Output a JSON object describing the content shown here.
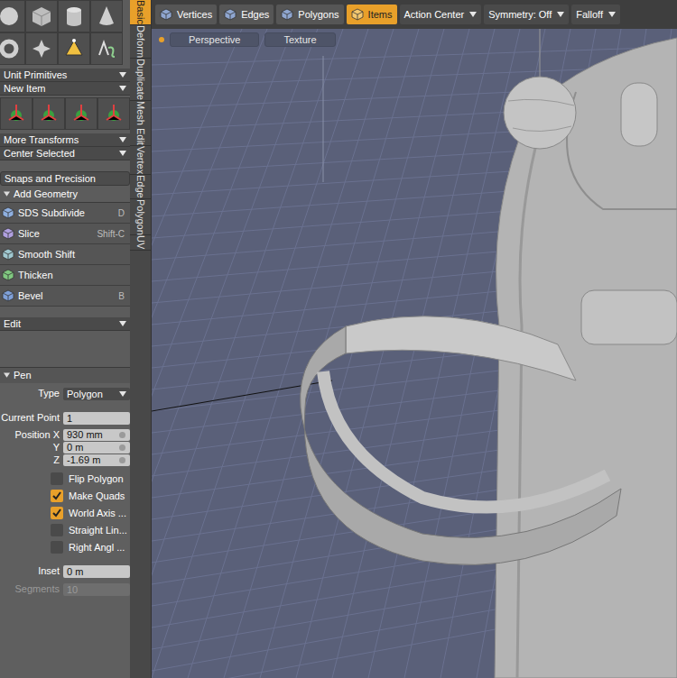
{
  "toolbar": {
    "modes": [
      {
        "label": "Vertices",
        "selected": false
      },
      {
        "label": "Edges",
        "selected": false
      },
      {
        "label": "Polygons",
        "selected": false
      },
      {
        "label": "Items",
        "selected": true
      }
    ],
    "menus": [
      "Action Center",
      "Symmetry: Off",
      "Falloff"
    ]
  },
  "viewport": {
    "labels": [
      "Perspective",
      "Texture"
    ]
  },
  "side_tabs": [
    {
      "label": "Basic",
      "selected": true
    },
    {
      "label": "Deform",
      "selected": false
    },
    {
      "label": "Duplicate",
      "selected": false
    },
    {
      "label": "Mesh Edit",
      "selected": false
    },
    {
      "label": "Vertex",
      "selected": false
    },
    {
      "label": "Edge",
      "selected": false
    },
    {
      "label": "Polygon",
      "selected": false
    },
    {
      "label": "UV",
      "selected": false
    }
  ],
  "primitive_dropdowns": [
    "Unit Primitives",
    "New Item"
  ],
  "transform_dropdowns": [
    "More Transforms",
    "Center Selected"
  ],
  "snaps_button": "Snaps and Precision",
  "add_geometry": {
    "title": "Add Geometry",
    "tools": [
      {
        "label": "SDS Subdivide",
        "shortcut": "D"
      },
      {
        "label": "Slice",
        "shortcut": "Shift-C"
      },
      {
        "label": "Smooth Shift",
        "shortcut": ""
      },
      {
        "label": "Thicken",
        "shortcut": ""
      },
      {
        "label": "Bevel",
        "shortcut": "B"
      }
    ]
  },
  "edit_dropdown": "Edit",
  "pen": {
    "title": "Pen",
    "type": {
      "label": "Type",
      "value": "Polygon"
    },
    "current_point": {
      "label": "Current Point",
      "value": "1"
    },
    "position": [
      {
        "label": "Position X",
        "value": "930 mm"
      },
      {
        "label": "Y",
        "value": "0 m"
      },
      {
        "label": "Z",
        "value": "-1.69 m"
      }
    ],
    "options": [
      {
        "label": "Flip Polygon",
        "checked": false
      },
      {
        "label": "Make Quads",
        "checked": true
      },
      {
        "label": "World Axis ...",
        "checked": true
      },
      {
        "label": "Straight Lin...",
        "checked": false
      },
      {
        "label": "Right Angl ...",
        "checked": false
      }
    ],
    "inset": {
      "label": "Inset",
      "value": "0 m"
    },
    "segments": {
      "label": "Segments",
      "value": "10",
      "disabled": true
    }
  }
}
